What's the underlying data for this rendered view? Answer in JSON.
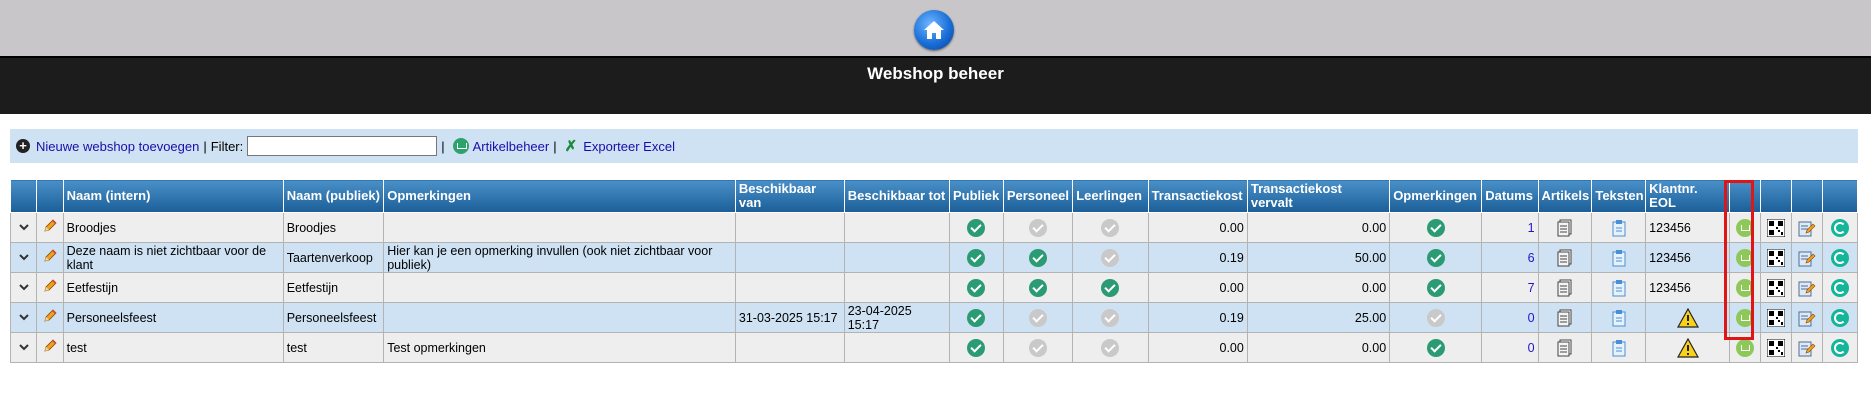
{
  "header": {
    "home_icon": "home-icon",
    "title": "Webshop beheer"
  },
  "toolbar": {
    "add_label": "Nieuwe webshop toevoegen",
    "filter_label": "Filter:",
    "filter_value": "",
    "article_label": "Artikelbeheer",
    "export_label": "Exporteer Excel",
    "pipe": "|"
  },
  "table": {
    "columns": [
      "",
      "",
      "Naam (intern)",
      "Naam (publiek)",
      "Opmerkingen",
      "Beschikbaar van",
      "Beschikbaar tot",
      "Publiek",
      "Personeel",
      "Leerlingen",
      "Transactiekost",
      "Transactiekost vervalt",
      "Opmerkingen",
      "Datums",
      "Artikels",
      "Teksten",
      "Klantnr. EOL",
      "",
      "",
      "",
      ""
    ],
    "rows": [
      {
        "naam_intern": "Broodjes",
        "naam_publiek": "Broodjes",
        "opmerkingen": "",
        "van": "",
        "tot": "",
        "publiek": true,
        "personeel": false,
        "leerlingen": false,
        "transactiekost": "0.00",
        "vervalt": "0.00",
        "opm_flag": true,
        "datums": "1",
        "klantnr": "123456",
        "warn": false
      },
      {
        "naam_intern": "Deze naam is niet zichtbaar voor de klant",
        "naam_publiek": "Taartenverkoop",
        "opmerkingen": "Hier kan je een opmerking invullen (ook niet zichtbaar voor publiek)",
        "van": "",
        "tot": "",
        "publiek": true,
        "personeel": true,
        "leerlingen": false,
        "transactiekost": "0.19",
        "vervalt": "50.00",
        "opm_flag": true,
        "datums": "6",
        "klantnr": "123456",
        "warn": false
      },
      {
        "naam_intern": "Eetfestijn",
        "naam_publiek": "Eetfestijn",
        "opmerkingen": "",
        "van": "",
        "tot": "",
        "publiek": true,
        "personeel": true,
        "leerlingen": true,
        "transactiekost": "0.00",
        "vervalt": "0.00",
        "opm_flag": true,
        "datums": "7",
        "klantnr": "123456",
        "warn": false
      },
      {
        "naam_intern": "Personeelsfeest",
        "naam_publiek": "Personeelsfeest",
        "opmerkingen": "",
        "van": "31-03-2025 15:17",
        "tot": "23-04-2025 15:17",
        "publiek": true,
        "personeel": false,
        "leerlingen": false,
        "transactiekost": "0.19",
        "vervalt": "25.00",
        "opm_flag": false,
        "datums": "0",
        "klantnr": "",
        "warn": true
      },
      {
        "naam_intern": "test",
        "naam_publiek": "test",
        "opmerkingen": "Test opmerkingen",
        "van": "",
        "tot": "",
        "publiek": true,
        "personeel": false,
        "leerlingen": false,
        "transactiekost": "0.00",
        "vervalt": "0.00",
        "opm_flag": true,
        "datums": "0",
        "klantnr": "",
        "warn": true
      }
    ]
  },
  "colors": {
    "header_gradient_top": "#4a90c8",
    "header_gradient_bottom": "#1b5e98",
    "row_odd": "#eeeeee",
    "row_even": "#cfe2f3",
    "check_on": "#2b9b74",
    "check_off": "#c9c9c9",
    "highlight": "#e01515"
  }
}
